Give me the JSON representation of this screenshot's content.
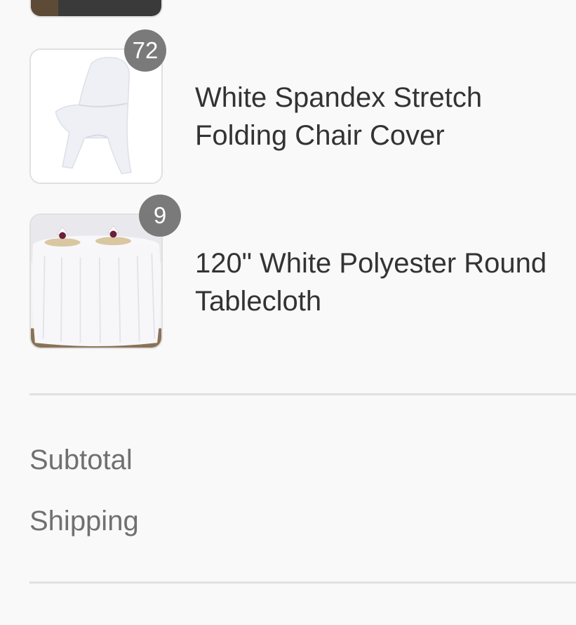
{
  "cart": {
    "items": [
      {
        "title_line1": "",
        "title_line2": "",
        "quantity": "",
        "image": "black-tablecloth-image"
      },
      {
        "title_line1": "White Spandex Stretch",
        "title_line2": "Folding Chair Cover",
        "quantity": "72",
        "image": "white-folding-chair-cover-image"
      },
      {
        "title_line1": "120\" White Polyester Round",
        "title_line2": "Tablecloth",
        "quantity": "9",
        "image": "white-round-tablecloth-image"
      }
    ]
  },
  "summary": {
    "subtotal_label": "Subtotal",
    "shipping_label": "Shipping"
  },
  "colors": {
    "background": "#f9f9f9",
    "badge": "#727272",
    "divider": "#e1e1e1"
  }
}
